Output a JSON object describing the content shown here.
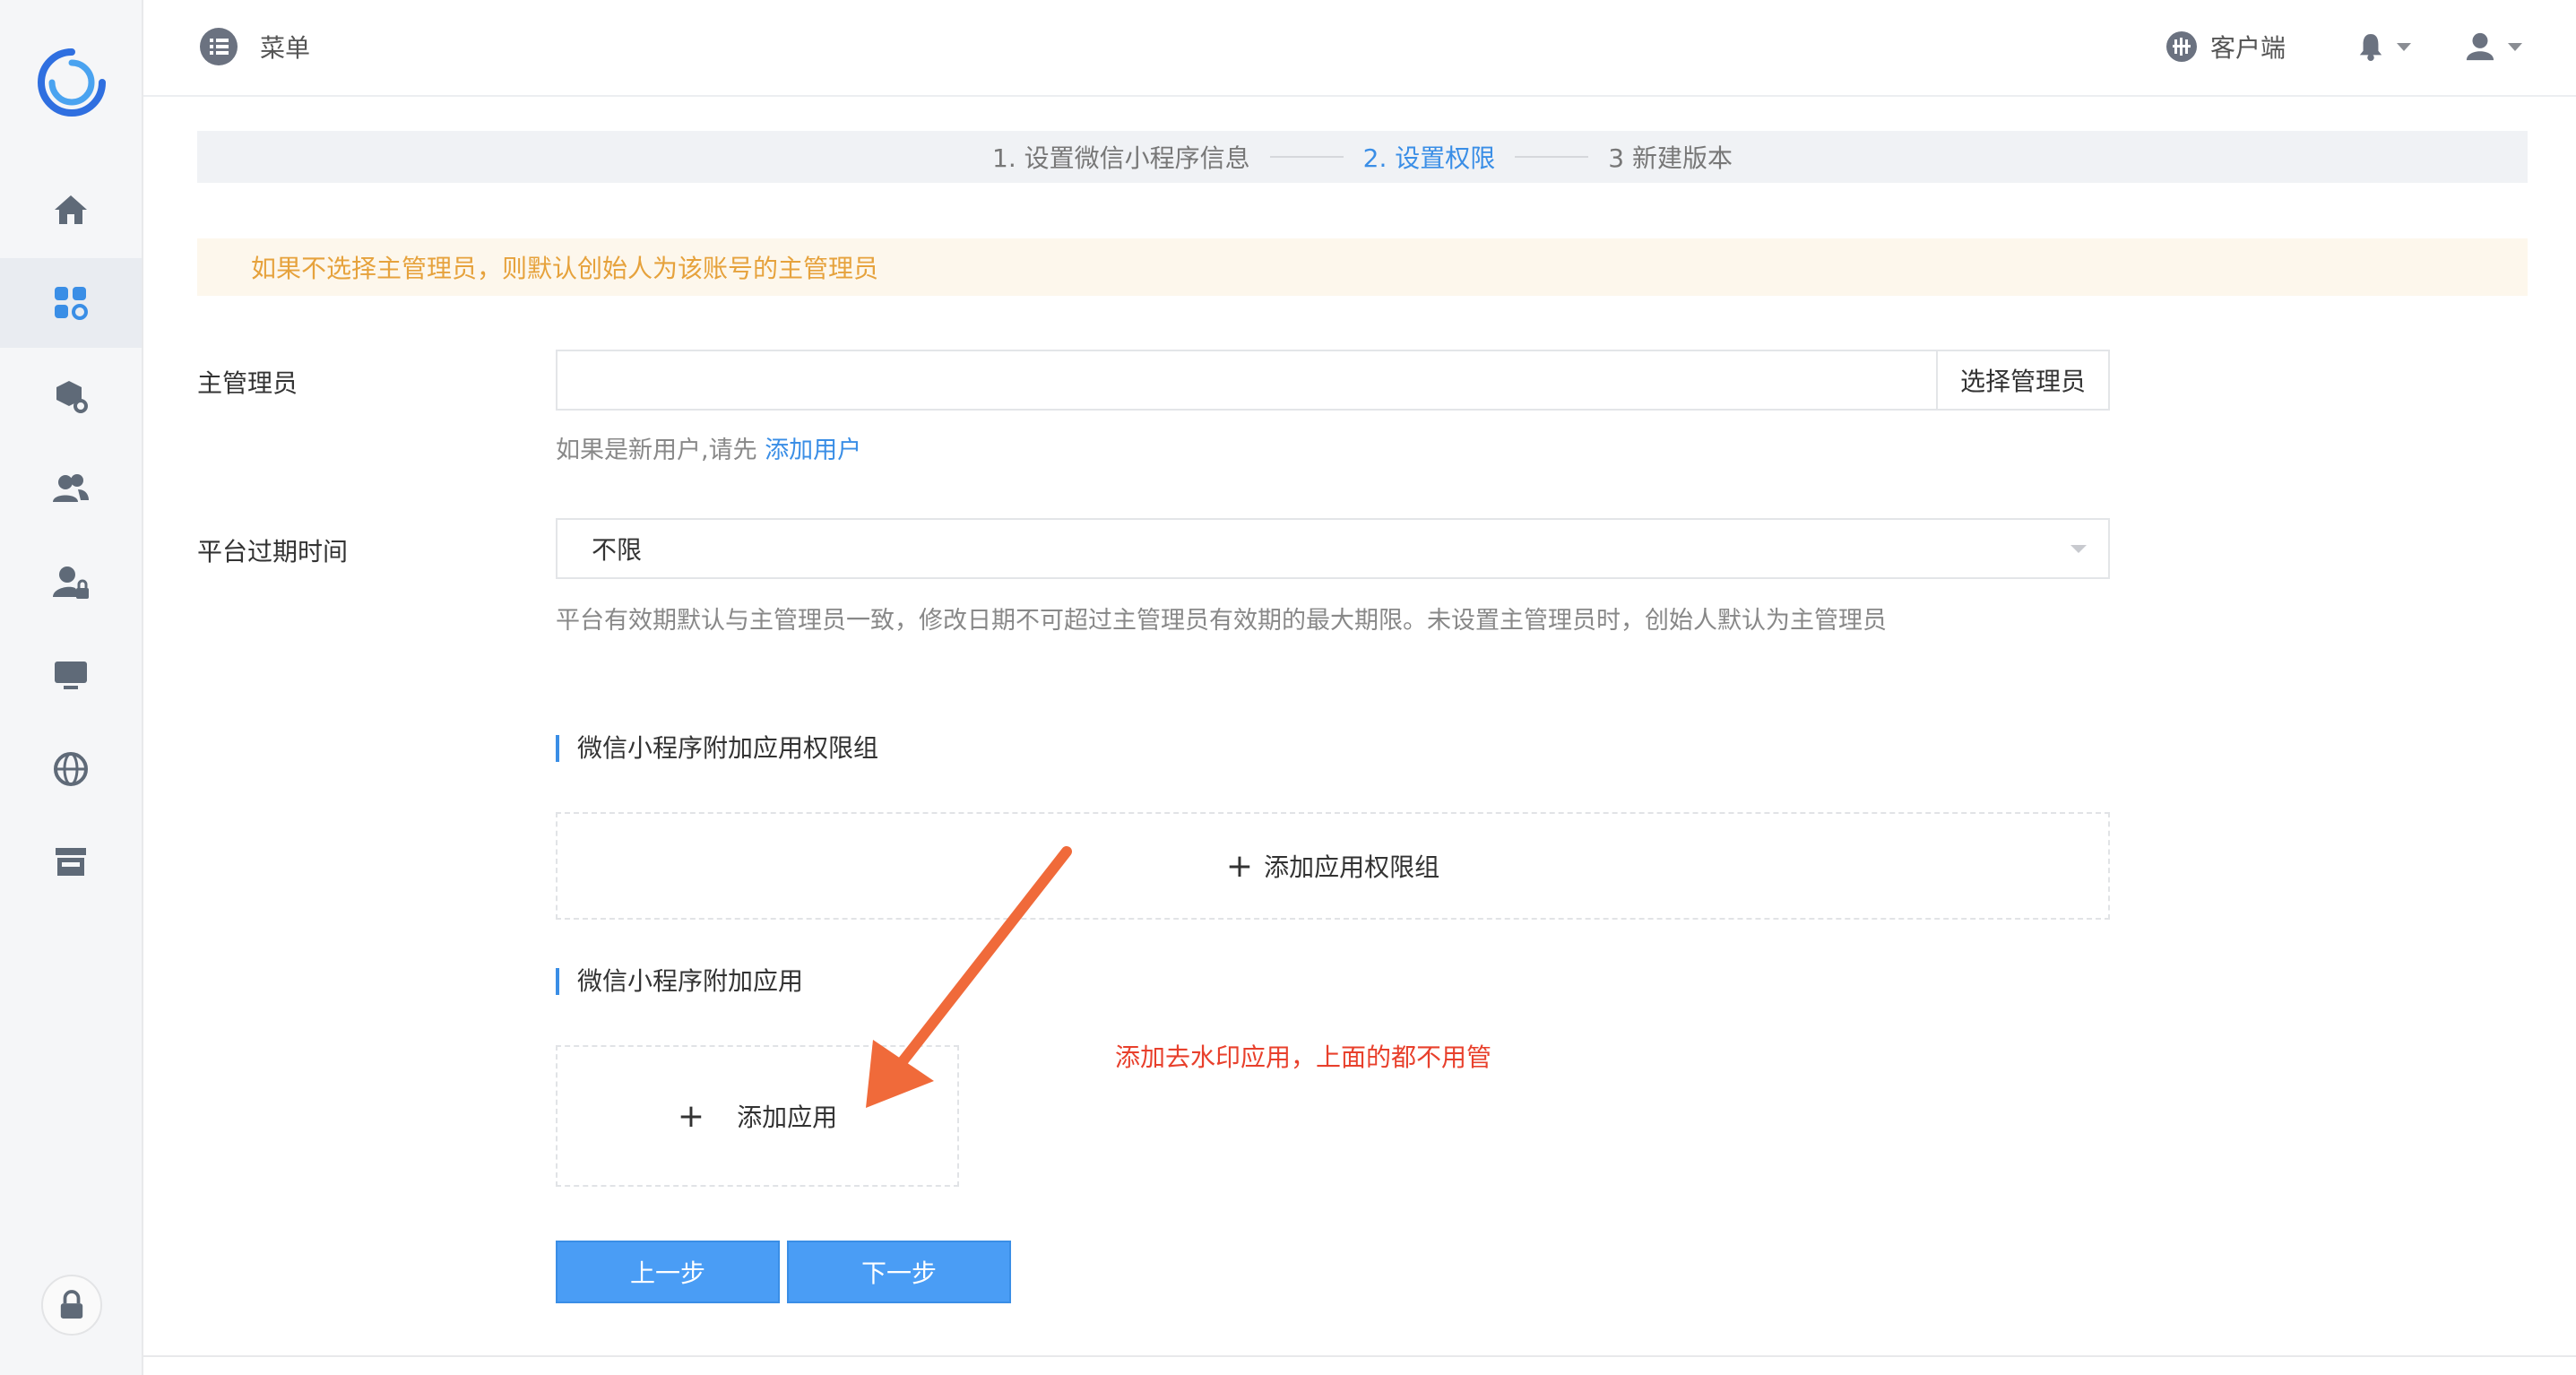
{
  "header": {
    "menu_label": "菜单",
    "client_label": "客户端"
  },
  "steps": [
    {
      "label": "1. 设置微信小程序信息",
      "active": false
    },
    {
      "label": "2. 设置权限",
      "active": true
    },
    {
      "label": "3 新建版本",
      "active": false
    }
  ],
  "warning": "如果不选择主管理员，则默认创始人为该账号的主管理员",
  "form": {
    "admin_label": "主管理员",
    "admin_value": "",
    "select_admin_button": "选择管理员",
    "new_user_hint": "如果是新用户,请先",
    "add_user_link": "添加用户",
    "expire_label": "平台过期时间",
    "expire_value": "不限",
    "expire_hint": "平台有效期默认与主管理员一致，修改日期不可超过主管理员有效期的最大期限。未设置主管理员时，创始人默认为主管理员"
  },
  "perm_group": {
    "title": "微信小程序附加应用权限组",
    "add_label": "添加应用权限组"
  },
  "apps": {
    "title": "微信小程序附加应用",
    "add_label": "添加应用"
  },
  "annotation": "添加去水印应用，上面的都不用管",
  "buttons": {
    "prev": "上一步",
    "next": "下一步"
  },
  "colors": {
    "accent": "#3a8ee6",
    "warning_text": "#e6a23c",
    "annotation_red": "#e8402c",
    "arrow_orange": "#f06a3a"
  }
}
